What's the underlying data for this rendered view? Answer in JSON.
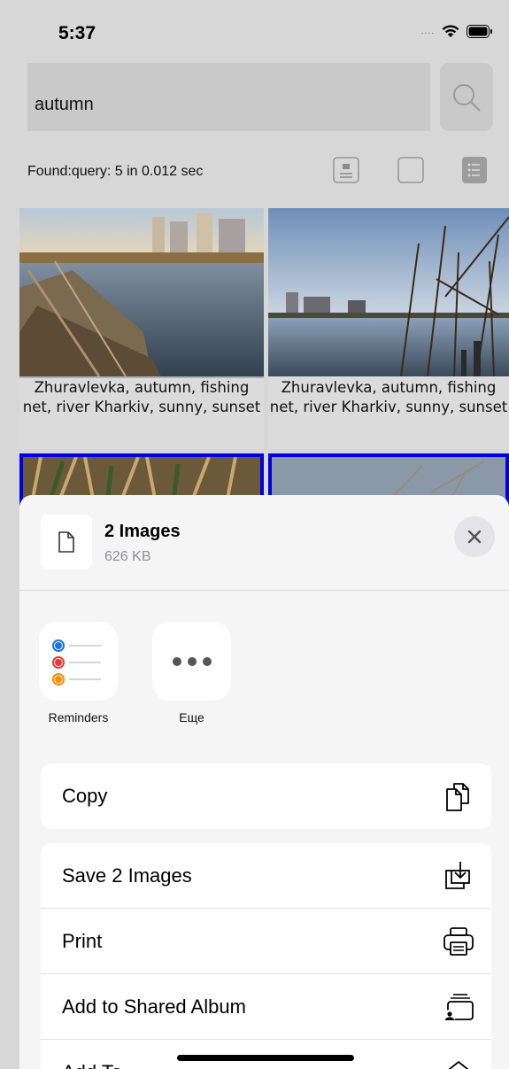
{
  "status_bar": {
    "time": "5:37",
    "signal": "...."
  },
  "search": {
    "value": "autumn",
    "placeholder": ""
  },
  "results": {
    "found_text": "Found:query: 5 in 0.012 sec"
  },
  "view_buttons": [
    {
      "icon": "caption-view-icon"
    },
    {
      "icon": "single-view-icon"
    },
    {
      "icon": "list-view-icon"
    }
  ],
  "photos": [
    {
      "caption": "Zhuravlevka, autumn, fishing net, river Kharkiv, sunny, sunset",
      "selected": false
    },
    {
      "caption": "Zhuravlevka, autumn, fishing net, river Kharkiv, sunny, sunset",
      "selected": false
    },
    {
      "caption": "",
      "selected": true
    },
    {
      "caption": "",
      "selected": true
    }
  ],
  "share_sheet": {
    "title": "2 Images",
    "size": "626 KB",
    "apps": [
      {
        "label": "Reminders",
        "icon": "reminders-icon"
      },
      {
        "label": "Еще",
        "icon": "more-icon"
      }
    ],
    "actions_group1": [
      {
        "label": "Copy",
        "icon": "copy-icon"
      }
    ],
    "actions_group2": [
      {
        "label": "Save 2 Images",
        "icon": "save-icon"
      },
      {
        "label": "Print",
        "icon": "print-icon"
      },
      {
        "label": "Add to Shared Album",
        "icon": "shared-album-icon"
      },
      {
        "label": "Add To...",
        "icon": "add-to-icon"
      }
    ]
  },
  "colors": {
    "selection_border": "#0000e0",
    "search_bg": "#c9c9c9",
    "sheet_bg": "#f5f5f6"
  }
}
